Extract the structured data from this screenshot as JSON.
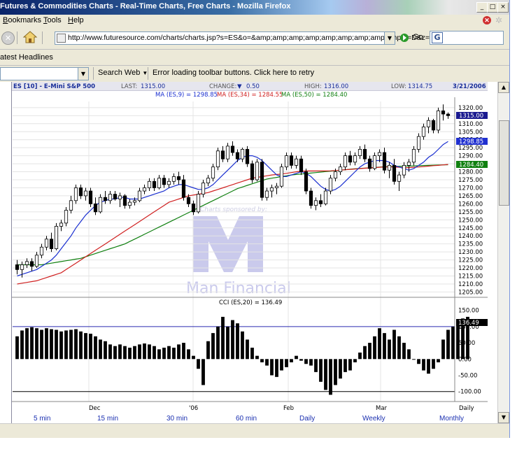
{
  "window": {
    "title": "Futures & Commodities Charts - Real-Time Charts, Free Charts - Mozilla Firefox",
    "controls": [
      "_",
      "□",
      "×"
    ]
  },
  "menu": {
    "items": [
      {
        "pre": "",
        "accel": "B",
        "post": "ookmarks"
      },
      {
        "pre": "",
        "accel": "T",
        "post": "ools"
      },
      {
        "pre": "",
        "accel": "H",
        "post": "elp"
      }
    ]
  },
  "navbar": {
    "url": "http://www.futuresource.com/charts/charts.jsp?s=ES&o=&amp;amp;amp;amp;amp;amp;amp;amp;amp;a=D&z=",
    "go_label": "Go",
    "search_logo": "G"
  },
  "bookmarks": {
    "label": "atest Headlines"
  },
  "toolbar": {
    "search_label": "Search Web",
    "error_text": "Error loading toolbar buttons. Click here to retry"
  },
  "chart_header": {
    "symbol": "ES [10] - E-Mini S&P 500",
    "last_label": "LAST:",
    "last_value": "1315.00",
    "change_label": "CHANGE:",
    "change_arrow": "▼",
    "change_value": "0.50",
    "high_label": "HIGH:",
    "high_value": "1316.00",
    "low_label": "LOW:",
    "low_value": "1314.75",
    "date": "3/21/2006"
  },
  "ma_legend": {
    "ma9": "MA (ES,9) = 1298.85",
    "ma34": "MA (ES,34) = 1284.55",
    "ma50": "MA (ES,50) = 1284.40"
  },
  "price_badges": {
    "last": "1315.00",
    "ma9": "1298.85",
    "ma50": "1284.40"
  },
  "watermark": {
    "sponsor_text": "Charts sponsored by:",
    "brand": "Man Financial"
  },
  "cci": {
    "label": "CCI (ES,20) = 136.49",
    "badge": "136.49",
    "ticks": [
      "150.00",
      "100.00",
      "50.00",
      "0.00",
      "-50.00",
      "-100.00"
    ]
  },
  "x_axis": {
    "labels": [
      "Dec",
      "'06",
      "Feb",
      "Mar",
      "Daily"
    ]
  },
  "intervals": [
    "5 min",
    "15 min",
    "30 min",
    "60 min",
    "Daily",
    "Weekly",
    "Monthly"
  ],
  "chart_data": {
    "type": "candlestick",
    "title": "ES [10] - E-Mini S&P 500",
    "y_ticks": [
      1320,
      1315,
      1310,
      1305,
      1300,
      1295,
      1290,
      1285,
      1280,
      1275,
      1270,
      1265,
      1260,
      1255,
      1250,
      1245,
      1240,
      1235,
      1230,
      1225,
      1220,
      1215,
      1210,
      1205
    ],
    "ylim": [
      1203,
      1323
    ],
    "grid": true,
    "ohlc": [
      [
        1222,
        1225,
        1216,
        1219
      ],
      [
        1219,
        1224,
        1214,
        1222
      ],
      [
        1222,
        1226,
        1220,
        1224
      ],
      [
        1224,
        1226,
        1218,
        1221
      ],
      [
        1221,
        1230,
        1220,
        1228
      ],
      [
        1228,
        1235,
        1226,
        1233
      ],
      [
        1233,
        1240,
        1231,
        1238
      ],
      [
        1238,
        1242,
        1230,
        1232
      ],
      [
        1232,
        1248,
        1231,
        1246
      ],
      [
        1246,
        1250,
        1243,
        1248
      ],
      [
        1248,
        1258,
        1246,
        1256
      ],
      [
        1256,
        1265,
        1254,
        1262
      ],
      [
        1262,
        1272,
        1260,
        1270
      ],
      [
        1270,
        1272,
        1263,
        1265
      ],
      [
        1265,
        1270,
        1262,
        1268
      ],
      [
        1268,
        1270,
        1258,
        1260
      ],
      [
        1260,
        1264,
        1253,
        1255
      ],
      [
        1255,
        1266,
        1254,
        1264
      ],
      [
        1264,
        1268,
        1260,
        1262
      ],
      [
        1262,
        1268,
        1260,
        1266
      ],
      [
        1266,
        1268,
        1262,
        1263
      ],
      [
        1263,
        1267,
        1258,
        1265
      ],
      [
        1265,
        1266,
        1257,
        1259
      ],
      [
        1259,
        1263,
        1257,
        1261
      ],
      [
        1261,
        1264,
        1259,
        1262
      ],
      [
        1262,
        1270,
        1261,
        1268
      ],
      [
        1268,
        1272,
        1266,
        1270
      ],
      [
        1270,
        1276,
        1268,
        1274
      ],
      [
        1274,
        1276,
        1268,
        1270
      ],
      [
        1270,
        1278,
        1269,
        1276
      ],
      [
        1276,
        1278,
        1270,
        1272
      ],
      [
        1272,
        1276,
        1270,
        1274
      ],
      [
        1274,
        1279,
        1272,
        1277
      ],
      [
        1277,
        1280,
        1272,
        1275
      ],
      [
        1275,
        1278,
        1262,
        1264
      ],
      [
        1264,
        1266,
        1258,
        1260
      ],
      [
        1260,
        1262,
        1253,
        1255
      ],
      [
        1255,
        1268,
        1254,
        1266
      ],
      [
        1266,
        1275,
        1264,
        1273
      ],
      [
        1273,
        1278,
        1271,
        1276
      ],
      [
        1276,
        1285,
        1274,
        1283
      ],
      [
        1283,
        1295,
        1281,
        1293
      ],
      [
        1293,
        1296,
        1286,
        1288
      ],
      [
        1288,
        1298,
        1286,
        1296
      ],
      [
        1296,
        1299,
        1290,
        1292
      ],
      [
        1292,
        1294,
        1286,
        1288
      ],
      [
        1288,
        1295,
        1286,
        1294
      ],
      [
        1294,
        1296,
        1283,
        1285
      ],
      [
        1285,
        1287,
        1273,
        1275
      ],
      [
        1275,
        1288,
        1274,
        1286
      ],
      [
        1286,
        1288,
        1262,
        1264
      ],
      [
        1264,
        1270,
        1262,
        1268
      ],
      [
        1268,
        1272,
        1264,
        1270
      ],
      [
        1270,
        1273,
        1266,
        1271
      ],
      [
        1271,
        1285,
        1270,
        1283
      ],
      [
        1283,
        1292,
        1281,
        1290
      ],
      [
        1290,
        1292,
        1282,
        1284
      ],
      [
        1284,
        1290,
        1282,
        1288
      ],
      [
        1288,
        1290,
        1278,
        1280
      ],
      [
        1280,
        1282,
        1266,
        1268
      ],
      [
        1268,
        1270,
        1257,
        1259
      ],
      [
        1259,
        1264,
        1256,
        1262
      ],
      [
        1262,
        1266,
        1258,
        1260
      ],
      [
        1260,
        1270,
        1259,
        1268
      ],
      [
        1268,
        1278,
        1266,
        1276
      ],
      [
        1276,
        1282,
        1274,
        1280
      ],
      [
        1280,
        1285,
        1278,
        1283
      ],
      [
        1283,
        1292,
        1281,
        1290
      ],
      [
        1290,
        1293,
        1284,
        1286
      ],
      [
        1286,
        1292,
        1284,
        1290
      ],
      [
        1290,
        1296,
        1288,
        1294
      ],
      [
        1294,
        1297,
        1286,
        1288
      ],
      [
        1288,
        1290,
        1280,
        1282
      ],
      [
        1282,
        1292,
        1281,
        1290
      ],
      [
        1290,
        1294,
        1286,
        1292
      ],
      [
        1292,
        1295,
        1279,
        1281
      ],
      [
        1281,
        1286,
        1276,
        1284
      ],
      [
        1284,
        1288,
        1272,
        1274
      ],
      [
        1274,
        1280,
        1268,
        1278
      ],
      [
        1278,
        1286,
        1276,
        1284
      ],
      [
        1284,
        1288,
        1280,
        1286
      ],
      [
        1286,
        1296,
        1284,
        1294
      ],
      [
        1294,
        1304,
        1292,
        1302
      ],
      [
        1302,
        1310,
        1300,
        1308
      ],
      [
        1308,
        1314,
        1304,
        1312
      ],
      [
        1312,
        1313,
        1304,
        1306
      ],
      [
        1306,
        1320,
        1304,
        1318
      ],
      [
        1318,
        1322,
        1312,
        1316
      ],
      [
        1316,
        1317,
        1313,
        1315
      ]
    ],
    "series": [
      {
        "name": "MA (ES,9)",
        "color": "#1a2fd0"
      },
      {
        "name": "MA (ES,34)",
        "color": "#d02020"
      },
      {
        "name": "MA (ES,50)",
        "color": "#108010"
      }
    ],
    "ma9": [
      1215,
      1216,
      1217,
      1218,
      1219,
      1221,
      1223,
      1225,
      1228,
      1232,
      1236,
      1240,
      1245,
      1249,
      1253,
      1256,
      1259,
      1261,
      1262,
      1263,
      1263,
      1264,
      1264,
      1263,
      1263,
      1263,
      1264,
      1265,
      1266,
      1267,
      1268,
      1270,
      1271,
      1272,
      1272,
      1271,
      1270,
      1269,
      1269,
      1270,
      1272,
      1275,
      1278,
      1281,
      1284,
      1287,
      1289,
      1290,
      1290,
      1289,
      1287,
      1284,
      1281,
      1278,
      1277,
      1277,
      1278,
      1279,
      1280,
      1279,
      1277,
      1274,
      1271,
      1269,
      1268,
      1269,
      1271,
      1274,
      1277,
      1280,
      1283,
      1285,
      1286,
      1287,
      1287,
      1287,
      1286,
      1284,
      1283,
      1282,
      1281,
      1282,
      1284,
      1286,
      1289,
      1291,
      1294,
      1297,
      1298.85
    ],
    "ma34": [
      1210,
      1210.5,
      1211,
      1211.5,
      1212,
      1213,
      1214,
      1215,
      1216,
      1217,
      1219,
      1221,
      1223,
      1225,
      1227,
      1229,
      1231,
      1233,
      1235,
      1237,
      1239,
      1241,
      1243,
      1245,
      1247,
      1249,
      1251,
      1253,
      1255,
      1257,
      1259,
      1261,
      1262,
      1263,
      1264,
      1265,
      1265.5,
      1266,
      1266.5,
      1267,
      1268,
      1269,
      1270,
      1271,
      1272,
      1273,
      1274,
      1275,
      1276,
      1276.5,
      1277,
      1277.5,
      1278,
      1278.3,
      1278.6,
      1279,
      1279.5,
      1280,
      1280.3,
      1280.5,
      1280.5,
      1280.5,
      1280.5,
      1280.5,
      1280.6,
      1280.8,
      1281,
      1281.3,
      1281.5,
      1281.7,
      1282,
      1282.2,
      1282.4,
      1282.6,
      1282.8,
      1283,
      1283,
      1283,
      1282.8,
      1282.6,
      1282.6,
      1282.8,
      1283,
      1283.2,
      1283.5,
      1283.8,
      1284,
      1284.3,
      1284.55
    ],
    "ma50": [
      1222,
      1222,
      1222,
      1222,
      1222,
      1222,
      1222.5,
      1223,
      1223.5,
      1224,
      1224.5,
      1225,
      1225.5,
      1226,
      1227,
      1228,
      1229,
      1230,
      1231,
      1232,
      1233,
      1234,
      1235,
      1236.5,
      1238,
      1239.5,
      1241,
      1242.5,
      1244,
      1245.5,
      1247,
      1248.5,
      1250,
      1251.5,
      1253,
      1254.5,
      1256,
      1257.5,
      1259,
      1260.5,
      1262,
      1263.5,
      1265,
      1266.5,
      1268,
      1269.5,
      1270.5,
      1271.5,
      1272.5,
      1273.5,
      1274.5,
      1275.5,
      1276,
      1276.5,
      1277,
      1277.5,
      1278,
      1278.3,
      1278.6,
      1278.9,
      1279.2,
      1279.5,
      1279.8,
      1280.1,
      1280.4,
      1280.7,
      1281,
      1281.3,
      1281.6,
      1281.9,
      1282.1,
      1282.3,
      1282.5,
      1282.7,
      1282.9,
      1283.1,
      1283.2,
      1283.3,
      1283.4,
      1283.5,
      1283.6,
      1283.7,
      1283.8,
      1283.9,
      1284,
      1284.1,
      1284.2,
      1284.3,
      1284.4
    ],
    "cci_values": [
      70,
      88,
      95,
      98,
      95,
      90,
      95,
      92,
      90,
      85,
      88,
      90,
      92,
      85,
      80,
      78,
      70,
      60,
      55,
      45,
      40,
      45,
      40,
      35,
      40,
      45,
      48,
      45,
      40,
      30,
      35,
      40,
      35,
      45,
      50,
      30,
      10,
      -30,
      -80,
      55,
      80,
      100,
      130,
      100,
      120,
      110,
      85,
      60,
      35,
      10,
      -10,
      -20,
      -50,
      -55,
      -35,
      -25,
      -10,
      10,
      -5,
      -15,
      -20,
      -40,
      -70,
      -95,
      -110,
      -80,
      -60,
      -40,
      -35,
      -10,
      20,
      40,
      50,
      70,
      95,
      80,
      60,
      90,
      70,
      50,
      30,
      0,
      -15,
      -35,
      -45,
      -30,
      -10,
      60,
      90,
      100,
      105,
      125,
      130
    ],
    "cci_ylim": [
      -120,
      160
    ],
    "cci_ref_lines": [
      100,
      -100
    ]
  }
}
